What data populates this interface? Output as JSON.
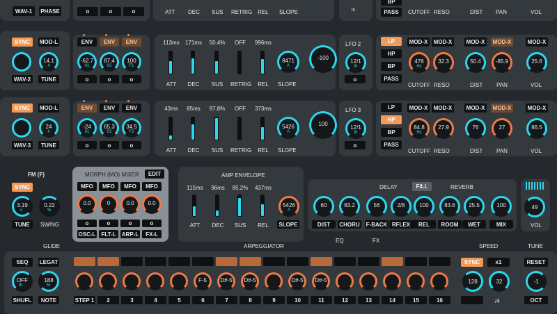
{
  "colors": {
    "accent": "#f29a57",
    "cyan": "#29d9f0",
    "bg": "#25292d",
    "panel": "#34393e"
  },
  "top": {
    "wav1": "WAV-1",
    "phase": "PHASE",
    "zeros": [
      "o",
      "o",
      "o"
    ],
    "slider_labels": [
      "ATT",
      "DEC",
      "SUS",
      "RETRIG",
      "REL",
      "SLOPE"
    ],
    "lfo_th": "th",
    "pass": "PASS",
    "bp": "BP",
    "cutoff": "CUTOFF",
    "reso": "RESO",
    "dist": "DIST",
    "pan": "PAN",
    "vol": "VOL"
  },
  "osc2": {
    "sync": "SYNC",
    "modl": "MOD-L",
    "wave": "WAV-2",
    "tune": "TUNE",
    "tune_val": "14.1",
    "tune_sub": "#",
    "env": [
      "ENV",
      "ENV",
      "ENV"
    ],
    "knobs": [
      "-62.7",
      "87.4",
      "100"
    ],
    "knob_subs": [
      "01",
      "02",
      "F1"
    ],
    "zeros": [
      "o",
      "o",
      "o"
    ],
    "amp": [
      "113ms",
      "171ms",
      "50.4%",
      "OFF",
      "996ms"
    ],
    "slope_val": "8471",
    "slope_sub": "/\\",
    "rate": "-100",
    "lfo": "LFO 2",
    "lfo_val": "12/1",
    "lfo_sub": "th",
    "lfo_zero": "o",
    "filter": [
      "LP",
      "HP",
      "BP",
      "PASS"
    ],
    "modx": [
      "MOD-X",
      "MOD-X",
      "MOD-X",
      "MOD-X",
      "MOD-X"
    ],
    "cutoff_val": "476",
    "cutoff_sub": "Hz",
    "reso_val": "32.3",
    "dist_val": "50.4",
    "pan_val": "-85.9",
    "vol_val": "25.6"
  },
  "osc3": {
    "sync": "SYNC",
    "modl": "MOD-L",
    "wave": "WAV-3",
    "tune": "TUNE",
    "tune_val": "24",
    "tune_sub": "#",
    "env": [
      "ENV",
      "ENV",
      "ENV"
    ],
    "knobs": [
      "-24",
      "65.3",
      "34.5"
    ],
    "knob_subs": [
      "01",
      "02",
      "F2"
    ],
    "zeros": [
      "o",
      "o",
      "o"
    ],
    "amp": [
      "43ms",
      "85ms",
      "97.8%",
      "OFF",
      "373ms"
    ],
    "slope_val": "5426",
    "slope_sub": "/\\",
    "rate": "100",
    "lfo": "LFO 3",
    "lfo_val": "12/1",
    "lfo_sub": "th",
    "lfo_zero": "o",
    "filter": [
      "LP",
      "HP",
      "BP",
      "PASS"
    ],
    "modx": [
      "MOD-X",
      "MOD-X",
      "MOD-X",
      "MOD-X",
      "MOD-X"
    ],
    "cutoff_val": "84.8",
    "cutoff_sub": "Hz",
    "reso_val": "27.9",
    "dist_val": "76",
    "pan_val": "27",
    "vol_val": "86.5"
  },
  "labels_row": [
    "ATT",
    "DEC",
    "SUS",
    "RETRIG",
    "REL",
    "SLOPE"
  ],
  "fm": {
    "title": "FM (F)",
    "sync": "SYNC",
    "tune_val": "3.19",
    "tune_sub": "x",
    "swing_val": "0.22",
    "swing_sub": "%",
    "tune": "TUNE",
    "swing": "SWING"
  },
  "morph": {
    "title": "MORPH (MO) MIXER",
    "edit": "EDIT",
    "mfo": [
      "MFO",
      "MFO",
      "MFO",
      "MFO"
    ],
    "knobs": [
      "0.0",
      "0",
      "0.0",
      "0.0"
    ],
    "zeros": [
      "o",
      "o",
      "o",
      "o"
    ],
    "outs": [
      "OSC-L",
      "FLT-L",
      "ARP-L",
      "FX-L"
    ]
  },
  "ampenv": {
    "title": "AMP ENVELOPE",
    "vals": [
      "115ms",
      "96ms",
      "85.2%",
      "437ms"
    ],
    "labels": [
      "ATT",
      "DEC",
      "SUS",
      "REL",
      "SLOPE"
    ],
    "slope_val": "5426",
    "slope_sub": "/\\"
  },
  "fx": {
    "delay": "DELAY",
    "fill": "FILL",
    "reverb": "REVERB",
    "knobs": [
      "60",
      "83.2",
      "56",
      "2/8",
      "100",
      "83.6",
      "25.5",
      "100"
    ],
    "labels": [
      "DIST",
      "CHORU",
      "F-BACK",
      "RFLEX",
      "REL",
      "ROOM",
      "WET",
      "MIX"
    ],
    "eq": "EQ",
    "fx": "FX",
    "vol_val": "49",
    "vol": "VOL"
  },
  "bottom": {
    "glide": "GLIDE",
    "arp": "ARPEGGIATOR",
    "speed": "SPEED",
    "tune": "TUNE",
    "seq": "SEQ",
    "legat": "LEGAT",
    "off": "OFF",
    "th": "th",
    "shufl": "SHUFL",
    "note_val": "188",
    "note_sub": "%",
    "note": "NOTE",
    "steps": [
      "STEP 1",
      "2",
      "3",
      "4",
      "5",
      "6",
      "7",
      "8",
      "9",
      "10",
      "11",
      "12",
      "13",
      "14",
      "15",
      "16"
    ],
    "notes": [
      "",
      "",
      "",
      "",
      "",
      "F-5",
      "D#-5",
      "D#-5",
      "",
      "D#-5",
      "D#-5",
      "",
      "",
      "",
      "",
      ""
    ],
    "sync": "SYNC",
    "x1": "x1",
    "reset": "RESET",
    "speed_vals": [
      "128",
      "32"
    ],
    "div": "/4",
    "tune_val": "-1",
    "oct": "OCT"
  }
}
